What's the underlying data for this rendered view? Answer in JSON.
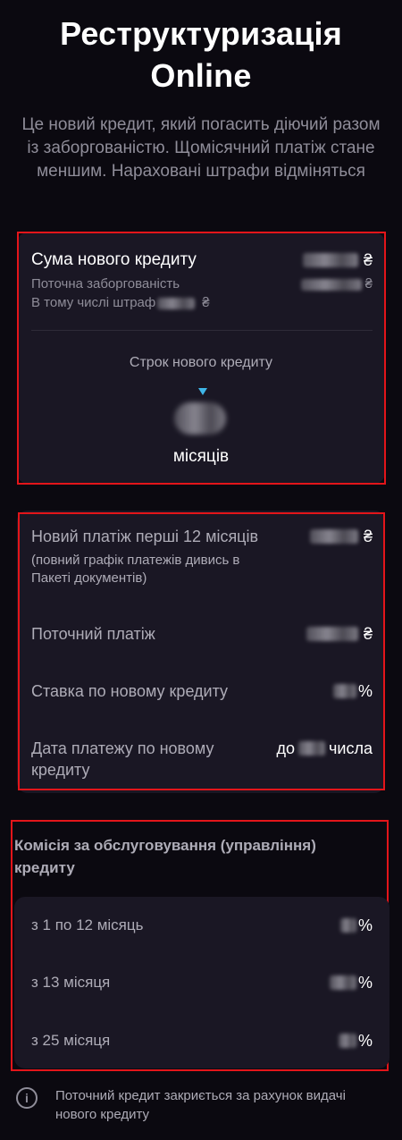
{
  "header": {
    "title_line1": "Реструктуризація",
    "title_line2": "Online",
    "subtitle": "Це новий кредит, який погасить діючий разом із заборгованістю. Щомісячний платіж стане меншим. Нараховані штрафи відміняться"
  },
  "loan_card": {
    "new_credit_sum_label": "Сума нового кредиту",
    "current_debt_label": "Поточна заборгованість",
    "fine_label": "В тому числі штраф",
    "currency": "₴",
    "term_label": "Строк нового кредиту",
    "months_label": "місяців"
  },
  "payment_card": {
    "new_payment_label": "Новий платіж перші 12 місяців",
    "new_payment_note": "(повний графік платежів дивись в Пакеті документів)",
    "current_payment_label": "Поточний платіж",
    "rate_label": "Ставка по новому кредиту",
    "percent": "%",
    "payment_date_label": "Дата платежу по новому кредиту",
    "payment_date_prefix": "до",
    "payment_date_suffix": "числа"
  },
  "commission": {
    "title": "Комісія за обслуговування (управління) кредиту",
    "rows": [
      {
        "label": "з 1 по 12 місяць"
      },
      {
        "label": "з 13 місяця"
      },
      {
        "label": "з 25 місяця"
      }
    ]
  },
  "footer": {
    "info_icon_glyph": "i",
    "note": "Поточний кредит закриється за рахунок видачі нового кредиту"
  },
  "colors": {
    "background": "#0b0910",
    "card": "#1a1724",
    "highlight_border": "#e3151a",
    "accent": "#3fb6e8"
  }
}
